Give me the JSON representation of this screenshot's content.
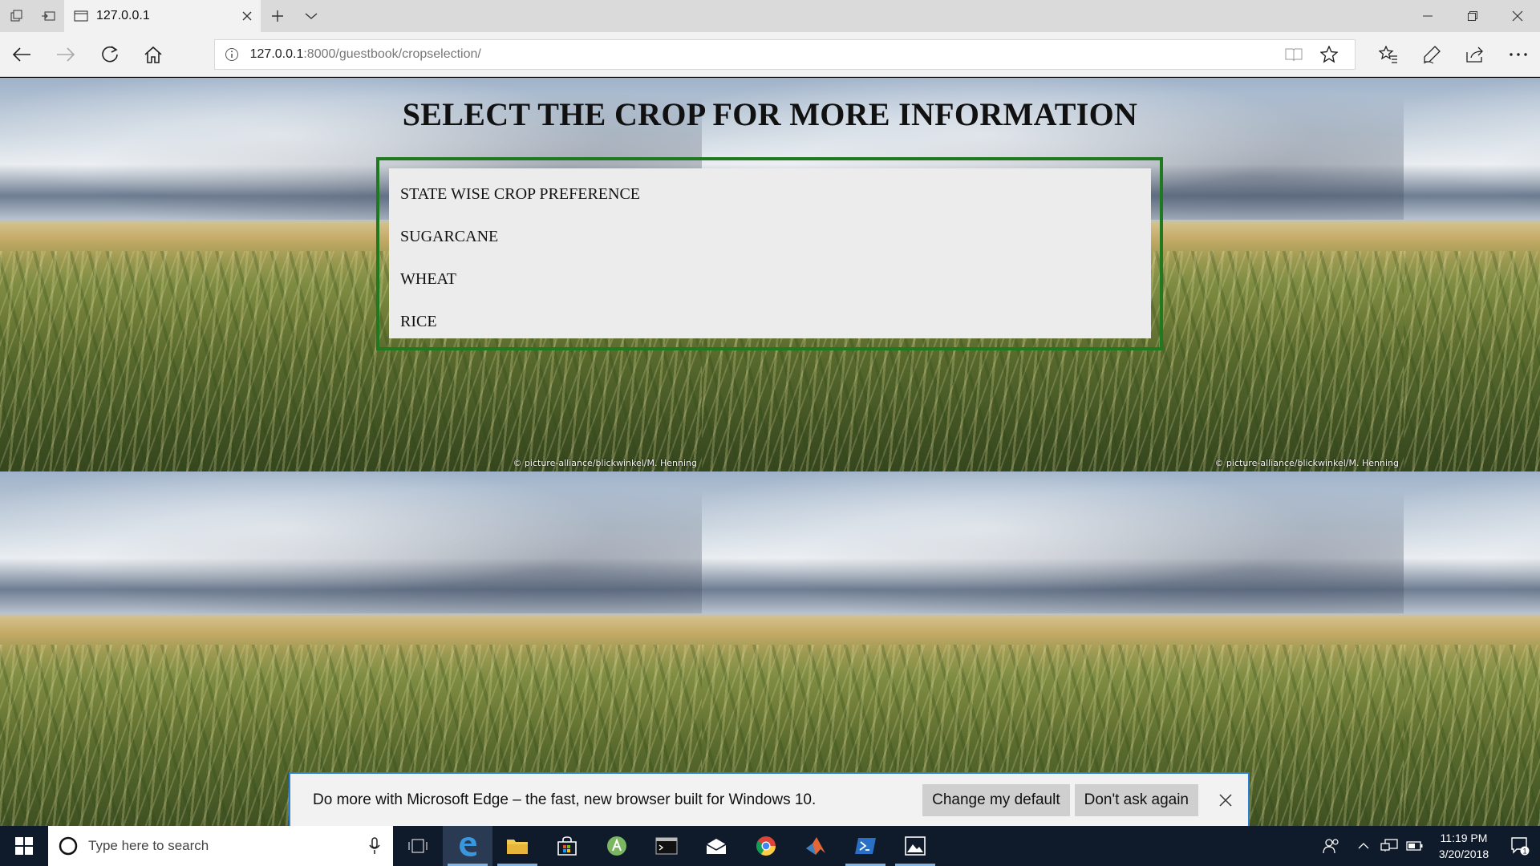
{
  "browser": {
    "tab_title": "127.0.0.1",
    "url_host": "127.0.0.1",
    "url_path": ":8000/guestbook/cropselection/"
  },
  "page": {
    "title": "SELECT THE CROP FOR MORE INFORMATION",
    "crop_items": [
      "STATE WISE CROP PREFERENCE",
      "SUGARCANE",
      "WHEAT",
      "RICE"
    ],
    "image_credit": "© picture-alliance/blickwinkel/M. Henning",
    "panel_border_color": "#1f7a1f"
  },
  "notification": {
    "message": "Do more with Microsoft Edge – the fast, new browser built for Windows 10.",
    "change_default_label": "Change my default",
    "dont_ask_label": "Don't ask again"
  },
  "taskbar": {
    "search_placeholder": "Type here to search",
    "time": "11:19 PM",
    "date": "3/20/2018",
    "notification_count": "1"
  }
}
